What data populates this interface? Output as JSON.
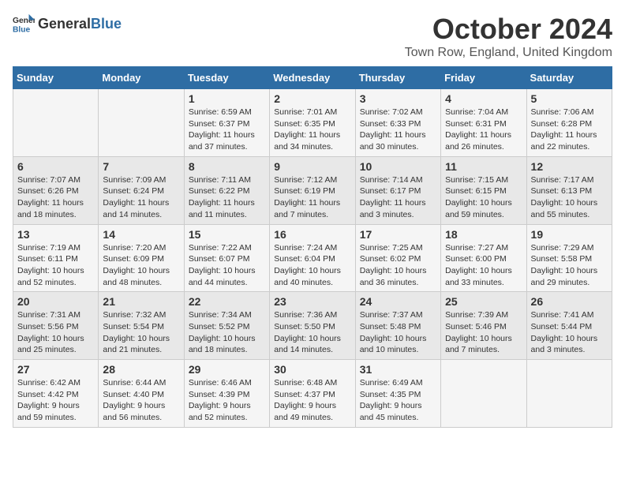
{
  "logo": {
    "general": "General",
    "blue": "Blue"
  },
  "title": "October 2024",
  "location": "Town Row, England, United Kingdom",
  "days_of_week": [
    "Sunday",
    "Monday",
    "Tuesday",
    "Wednesday",
    "Thursday",
    "Friday",
    "Saturday"
  ],
  "weeks": [
    [
      {
        "day": "",
        "info": ""
      },
      {
        "day": "",
        "info": ""
      },
      {
        "day": "1",
        "info": "Sunrise: 6:59 AM\nSunset: 6:37 PM\nDaylight: 11 hours and 37 minutes."
      },
      {
        "day": "2",
        "info": "Sunrise: 7:01 AM\nSunset: 6:35 PM\nDaylight: 11 hours and 34 minutes."
      },
      {
        "day": "3",
        "info": "Sunrise: 7:02 AM\nSunset: 6:33 PM\nDaylight: 11 hours and 30 minutes."
      },
      {
        "day": "4",
        "info": "Sunrise: 7:04 AM\nSunset: 6:31 PM\nDaylight: 11 hours and 26 minutes."
      },
      {
        "day": "5",
        "info": "Sunrise: 7:06 AM\nSunset: 6:28 PM\nDaylight: 11 hours and 22 minutes."
      }
    ],
    [
      {
        "day": "6",
        "info": "Sunrise: 7:07 AM\nSunset: 6:26 PM\nDaylight: 11 hours and 18 minutes."
      },
      {
        "day": "7",
        "info": "Sunrise: 7:09 AM\nSunset: 6:24 PM\nDaylight: 11 hours and 14 minutes."
      },
      {
        "day": "8",
        "info": "Sunrise: 7:11 AM\nSunset: 6:22 PM\nDaylight: 11 hours and 11 minutes."
      },
      {
        "day": "9",
        "info": "Sunrise: 7:12 AM\nSunset: 6:19 PM\nDaylight: 11 hours and 7 minutes."
      },
      {
        "day": "10",
        "info": "Sunrise: 7:14 AM\nSunset: 6:17 PM\nDaylight: 11 hours and 3 minutes."
      },
      {
        "day": "11",
        "info": "Sunrise: 7:15 AM\nSunset: 6:15 PM\nDaylight: 10 hours and 59 minutes."
      },
      {
        "day": "12",
        "info": "Sunrise: 7:17 AM\nSunset: 6:13 PM\nDaylight: 10 hours and 55 minutes."
      }
    ],
    [
      {
        "day": "13",
        "info": "Sunrise: 7:19 AM\nSunset: 6:11 PM\nDaylight: 10 hours and 52 minutes."
      },
      {
        "day": "14",
        "info": "Sunrise: 7:20 AM\nSunset: 6:09 PM\nDaylight: 10 hours and 48 minutes."
      },
      {
        "day": "15",
        "info": "Sunrise: 7:22 AM\nSunset: 6:07 PM\nDaylight: 10 hours and 44 minutes."
      },
      {
        "day": "16",
        "info": "Sunrise: 7:24 AM\nSunset: 6:04 PM\nDaylight: 10 hours and 40 minutes."
      },
      {
        "day": "17",
        "info": "Sunrise: 7:25 AM\nSunset: 6:02 PM\nDaylight: 10 hours and 36 minutes."
      },
      {
        "day": "18",
        "info": "Sunrise: 7:27 AM\nSunset: 6:00 PM\nDaylight: 10 hours and 33 minutes."
      },
      {
        "day": "19",
        "info": "Sunrise: 7:29 AM\nSunset: 5:58 PM\nDaylight: 10 hours and 29 minutes."
      }
    ],
    [
      {
        "day": "20",
        "info": "Sunrise: 7:31 AM\nSunset: 5:56 PM\nDaylight: 10 hours and 25 minutes."
      },
      {
        "day": "21",
        "info": "Sunrise: 7:32 AM\nSunset: 5:54 PM\nDaylight: 10 hours and 21 minutes."
      },
      {
        "day": "22",
        "info": "Sunrise: 7:34 AM\nSunset: 5:52 PM\nDaylight: 10 hours and 18 minutes."
      },
      {
        "day": "23",
        "info": "Sunrise: 7:36 AM\nSunset: 5:50 PM\nDaylight: 10 hours and 14 minutes."
      },
      {
        "day": "24",
        "info": "Sunrise: 7:37 AM\nSunset: 5:48 PM\nDaylight: 10 hours and 10 minutes."
      },
      {
        "day": "25",
        "info": "Sunrise: 7:39 AM\nSunset: 5:46 PM\nDaylight: 10 hours and 7 minutes."
      },
      {
        "day": "26",
        "info": "Sunrise: 7:41 AM\nSunset: 5:44 PM\nDaylight: 10 hours and 3 minutes."
      }
    ],
    [
      {
        "day": "27",
        "info": "Sunrise: 6:42 AM\nSunset: 4:42 PM\nDaylight: 9 hours and 59 minutes."
      },
      {
        "day": "28",
        "info": "Sunrise: 6:44 AM\nSunset: 4:40 PM\nDaylight: 9 hours and 56 minutes."
      },
      {
        "day": "29",
        "info": "Sunrise: 6:46 AM\nSunset: 4:39 PM\nDaylight: 9 hours and 52 minutes."
      },
      {
        "day": "30",
        "info": "Sunrise: 6:48 AM\nSunset: 4:37 PM\nDaylight: 9 hours and 49 minutes."
      },
      {
        "day": "31",
        "info": "Sunrise: 6:49 AM\nSunset: 4:35 PM\nDaylight: 9 hours and 45 minutes."
      },
      {
        "day": "",
        "info": ""
      },
      {
        "day": "",
        "info": ""
      }
    ]
  ]
}
